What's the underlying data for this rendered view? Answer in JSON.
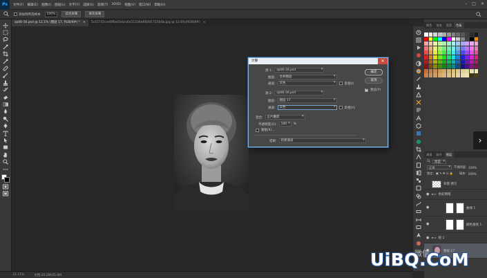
{
  "app": {
    "logo": "Ps"
  },
  "menu": {
    "items": [
      "文件(F)",
      "编辑(E)",
      "图像(I)",
      "图层(L)",
      "文字(Y)",
      "选择(S)",
      "滤镜(T)",
      "3D(D)",
      "视图(V)",
      "窗口(W)",
      "帮助(H)"
    ]
  },
  "window_controls": [
    "–",
    "□",
    "✕"
  ],
  "options_bar": {
    "sample_all_layers": "添加到所选样本",
    "zoom": "100%",
    "fit_screen": "适合屏幕",
    "fill_screen": "填充屏幕"
  },
  "tabs": [
    {
      "label": "zp06-16.psd @ 12.1% (图层 17, RGB/8#) *",
      "active": true
    },
    {
      "label": "5c45735ced0f6e/5eb/a6a52336e6fbf41725b0b.jpg @ 12.6%(RGB/8#)",
      "active": false
    }
  ],
  "status": {
    "zoom": "12.11%",
    "doc": "文档:20.2M/45.4M"
  },
  "dialog": {
    "title": "计算",
    "close": "✕",
    "source1": {
      "label": "源 1:",
      "file": "zp06-16.psd",
      "layer_label": "图层:",
      "layer": "合并图层",
      "channel_label": "通道:",
      "channel": "灰色",
      "invert": "反相(I)"
    },
    "source2": {
      "label": "源 2:",
      "file": "zp06-16.psd",
      "layer_label": "图层:",
      "layer": "图层 17",
      "channel_label": "通道:",
      "channel": "灰色",
      "invert": "反相(V)"
    },
    "blending_label": "混合:",
    "blending": "正片叠底",
    "opacity_label": "不透明度(O):",
    "opacity": "100",
    "opacity_unit": "%",
    "mask": "蒙版(K)...",
    "result_label": "结果:",
    "result": "新建通道",
    "ok": "确定",
    "cancel": "取消",
    "preview": "预览(P)"
  },
  "panels": {
    "top_tabs": [
      "颜色",
      "渐变",
      "图案",
      "色板"
    ],
    "bottom_tabs": [
      "通道",
      "路径",
      "图层"
    ],
    "filter_label": "类型",
    "blend_mode": "正常",
    "opacity_label": "不透明度:",
    "opacity": "100%",
    "lock_label": "锁定:",
    "fill_label": "填充:",
    "fill": "100%",
    "layers": [
      {
        "name": "背景 拷贝"
      },
      {
        "name": "色彩明暗"
      },
      {
        "name": "曲线 1"
      },
      {
        "name": "颜色查找 1"
      },
      {
        "name": "组 1"
      },
      {
        "name": "图层 17"
      }
    ]
  },
  "watermark": {
    "text": "UiBQ.CoM",
    "logo_text": "微信"
  },
  "colors": {
    "accent": "#31a8ff",
    "dialog_border": "#8ab4df",
    "close": "#c74a3f"
  }
}
